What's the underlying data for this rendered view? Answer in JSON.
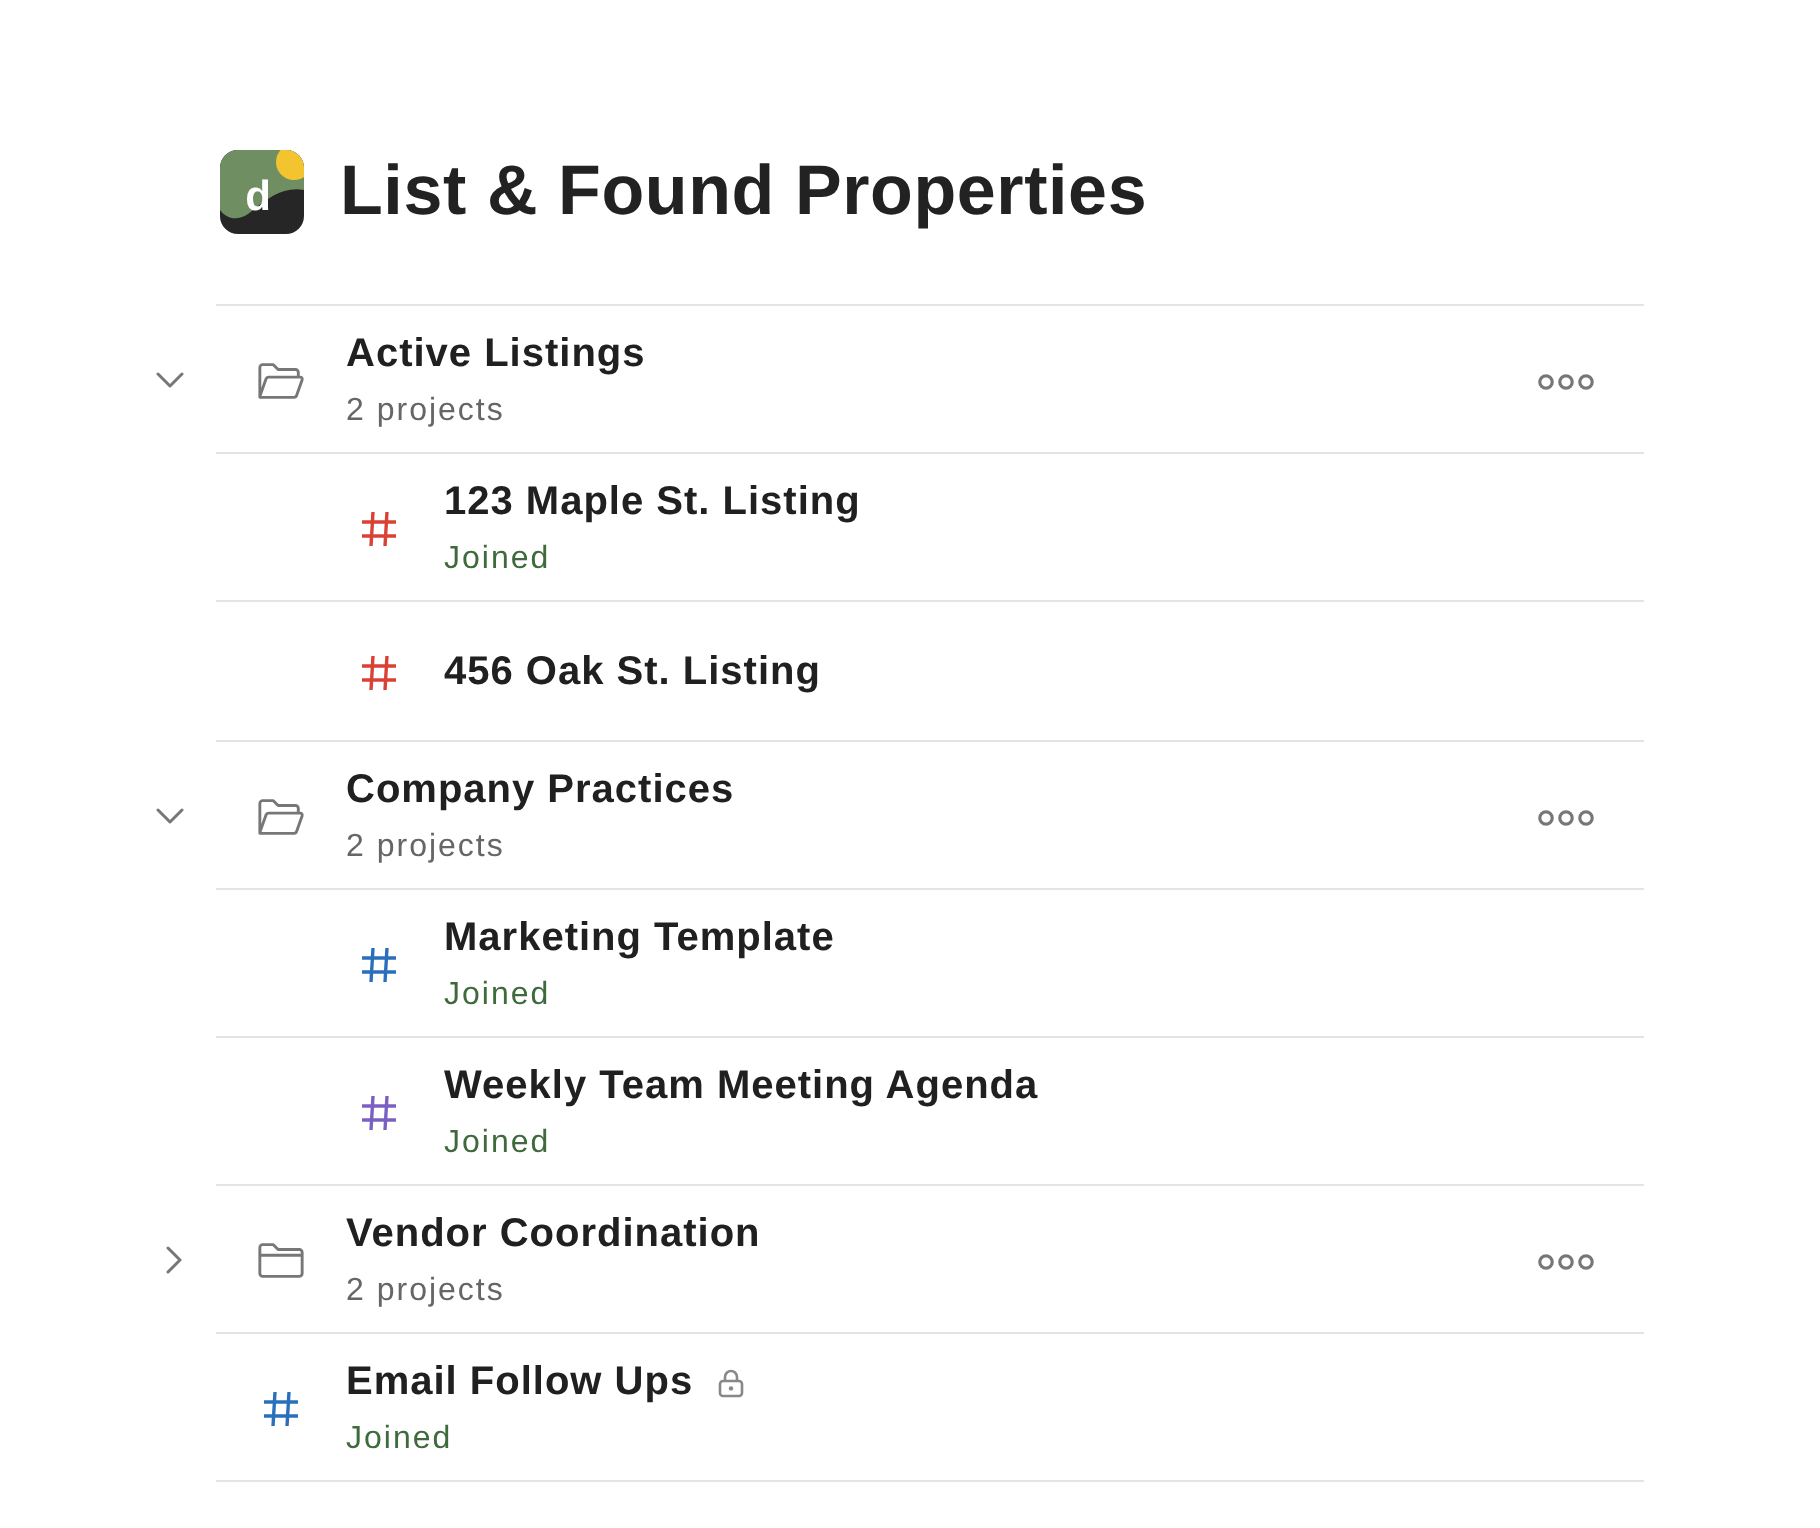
{
  "header": {
    "logo_text": "d",
    "title": "List & Found Properties"
  },
  "items": [
    {
      "kind": "folder",
      "name": "Active Listings",
      "count": "2 projects",
      "expanded": true,
      "children": [
        {
          "kind": "project",
          "name": "123 Maple St. Listing",
          "status": "Joined",
          "color": "#db4035",
          "locked": false
        },
        {
          "kind": "project",
          "name": "456 Oak St. Listing",
          "color": "#db4035",
          "locked": false
        }
      ]
    },
    {
      "kind": "folder",
      "name": "Company Practices",
      "count": "2 projects",
      "expanded": true,
      "children": [
        {
          "kind": "project",
          "name": "Marketing Template",
          "status": "Joined",
          "color": "#2a6fbb",
          "locked": false
        },
        {
          "kind": "project",
          "name": "Weekly Team Meeting Agenda",
          "status": "Joined",
          "color": "#7b60c4",
          "locked": false
        }
      ]
    },
    {
      "kind": "folder",
      "name": "Vendor Coordination",
      "count": "2 projects",
      "expanded": false
    },
    {
      "kind": "project",
      "name": "Email Follow Ups",
      "status": "Joined",
      "color": "#2a6fbb",
      "locked": true
    }
  ]
}
